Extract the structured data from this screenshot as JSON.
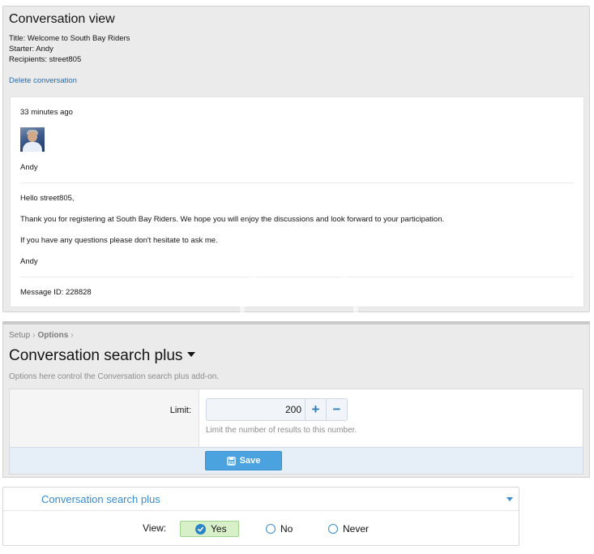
{
  "conversation": {
    "heading": "Conversation view",
    "title_line": "Title: Welcome to South Bay Riders",
    "starter_line": "Starter: Andy",
    "recipients_line": "Recipients: street805",
    "delete_link": "Delete conversation",
    "message": {
      "timestamp": "33 minutes ago",
      "author": "Andy",
      "greeting": "Hello street805,",
      "body1": "Thank you for registering at South Bay Riders. We hope you will enjoy the discussions and look forward to your participation.",
      "body2": "If you have any questions please don't hesitate to ask me.",
      "signature": "Andy",
      "message_id": "Message ID: 228828"
    }
  },
  "options_page": {
    "breadcrumb": [
      "Setup",
      "Options"
    ],
    "title": "Conversation search plus",
    "description": "Options here control the Conversation search plus add-on.",
    "limit_label": "Limit:",
    "limit_value": "200",
    "increment_symbol": "+",
    "decrement_symbol": "−",
    "limit_hint": "Limit the number of results to this number.",
    "save_label": "Save",
    "save_icon": "floppy-disk-icon"
  },
  "view_settings": {
    "title": "Conversation search plus",
    "view_label": "View:",
    "options": [
      {
        "label": "Yes",
        "selected": true
      },
      {
        "label": "No",
        "selected": false
      },
      {
        "label": "Never",
        "selected": false
      }
    ]
  },
  "colors": {
    "link": "#2b6aa8",
    "accent": "#3a8ccf",
    "save_button": "#4aa3df",
    "selected_option": "#d7f0c9"
  }
}
